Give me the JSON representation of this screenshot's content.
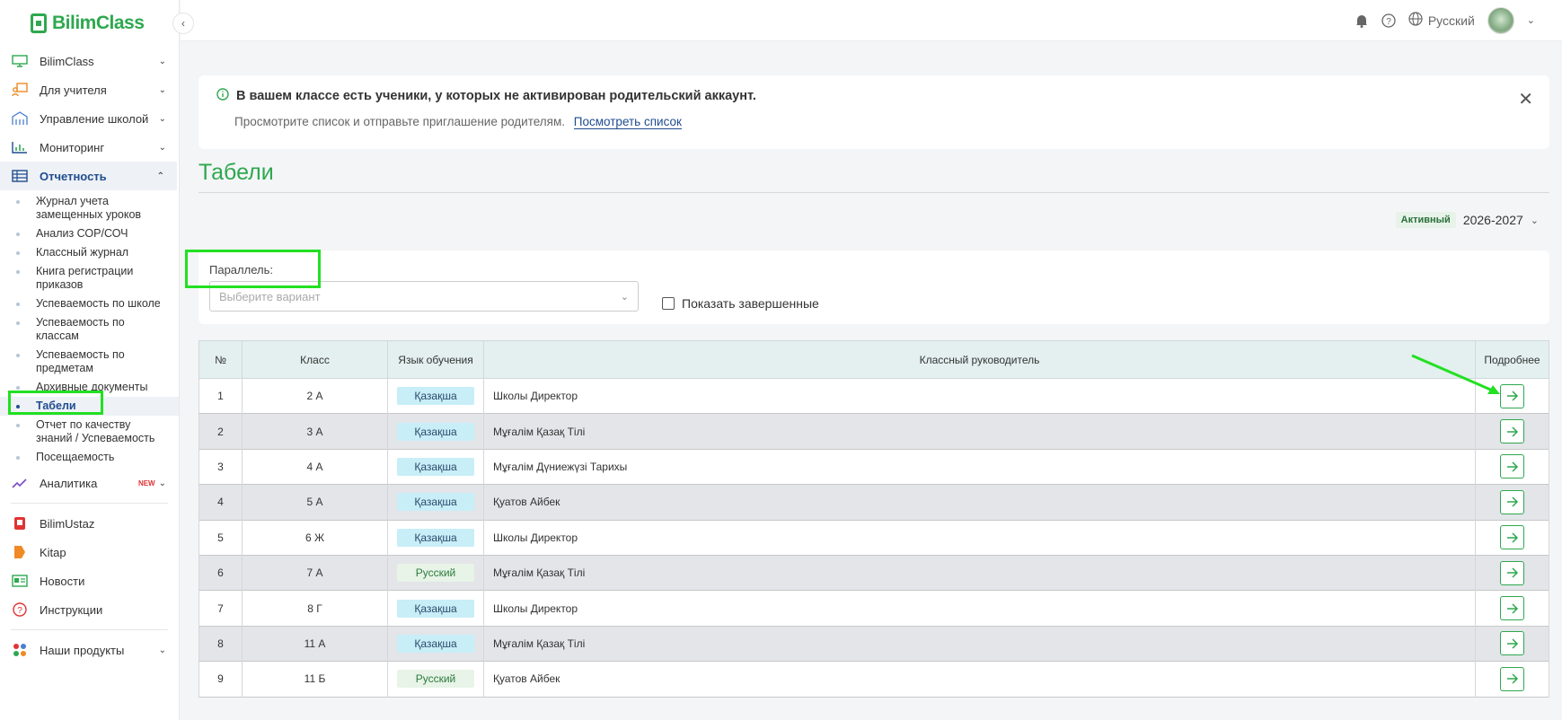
{
  "brand": {
    "name": "BilimClass"
  },
  "sidebar": {
    "items": [
      {
        "label": "BilimClass",
        "icon": "monitor-icon"
      },
      {
        "label": "Для учителя",
        "icon": "teacher-icon"
      },
      {
        "label": "Управление школой",
        "icon": "school-icon"
      },
      {
        "label": "Мониторинг",
        "icon": "chart-icon"
      },
      {
        "label": "Отчетность",
        "icon": "table-icon"
      }
    ],
    "sub_items": [
      "Журнал учета замещенных уроков",
      "Анализ СОР/СОЧ",
      "Классный журнал",
      "Книга регистрации приказов",
      "Успеваемость по школе",
      "Успеваемость по классам",
      "Успеваемость по предметам",
      "Архивные документы",
      "Табели",
      "Отчет по качеству знаний / Успеваемость",
      "Посещаемость"
    ],
    "analytics": {
      "label": "Аналитика",
      "badge": "NEW"
    },
    "extra": [
      {
        "label": "BilimUstaz",
        "icon": "bilimustaz-icon"
      },
      {
        "label": "Kitap",
        "icon": "kitap-icon"
      },
      {
        "label": "Новости",
        "icon": "news-icon"
      },
      {
        "label": "Инструкции",
        "icon": "help-icon"
      }
    ],
    "products": {
      "label": "Наши продукты"
    }
  },
  "header": {
    "language": "Русский"
  },
  "alert": {
    "title": "В вашем классе есть ученики, у которых не активирован родительский аккаунт.",
    "text": "Просмотрите список и отправьте приглашение родителям.",
    "link": "Посмотреть список"
  },
  "page": {
    "title": "Табели"
  },
  "year": {
    "badge": "Активный",
    "value": "2026-2027"
  },
  "filters": {
    "parallel_label": "Параллель:",
    "parallel_placeholder": "Выберите вариант",
    "show_completed": "Показать завершенные"
  },
  "table": {
    "headers": [
      "№",
      "Класс",
      "Язык обучения",
      "Классный руководитель",
      "Подробнее"
    ],
    "rows": [
      {
        "num": "1",
        "class": "2 А",
        "lang": "Қазақша",
        "teacher": "Школы Директор"
      },
      {
        "num": "2",
        "class": "3 А",
        "lang": "Қазақша",
        "teacher": "Мұғалім Қазақ Тілі"
      },
      {
        "num": "3",
        "class": "4 А",
        "lang": "Қазақша",
        "teacher": "Мұғалім Дүниежүзі Тарихы"
      },
      {
        "num": "4",
        "class": "5 А",
        "lang": "Қазақша",
        "teacher": "Қуатов Айбек"
      },
      {
        "num": "5",
        "class": "6 Ж",
        "lang": "Қазақша",
        "teacher": "Школы Директор"
      },
      {
        "num": "6",
        "class": "7 А",
        "lang": "Русский",
        "teacher": "Мұғалім Қазақ Тілі"
      },
      {
        "num": "7",
        "class": "8 Г",
        "lang": "Қазақша",
        "teacher": "Школы Директор"
      },
      {
        "num": "8",
        "class": "11 А",
        "lang": "Қазақша",
        "teacher": "Мұғалім Қазақ Тілі"
      },
      {
        "num": "9",
        "class": "11 Б",
        "lang": "Русский",
        "teacher": "Қуатов Айбек"
      }
    ]
  },
  "colors": {
    "brand_green": "#2ea84f",
    "active_blue": "#1f4c8f",
    "highlight": "#22e022"
  }
}
